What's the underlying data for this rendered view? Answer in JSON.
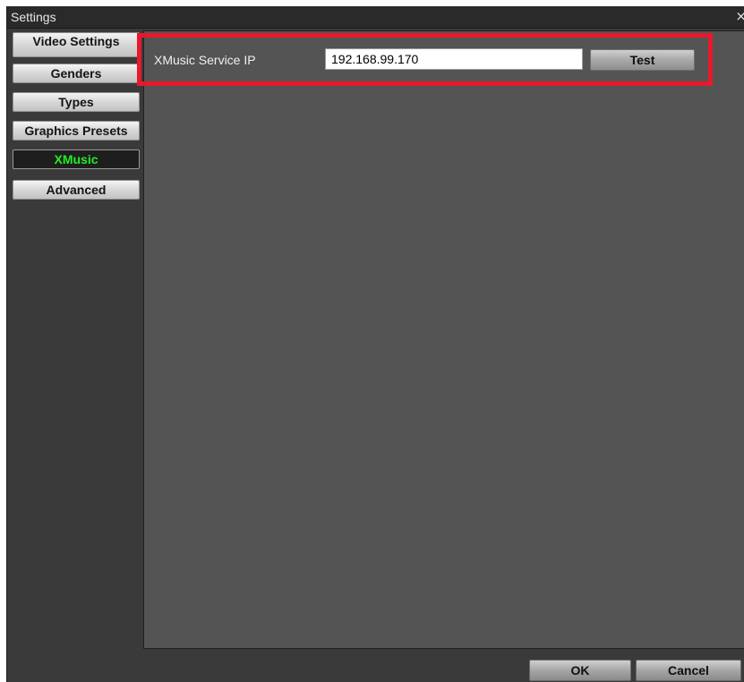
{
  "window": {
    "title": "Settings",
    "close_glyph": "×"
  },
  "sidebar": {
    "items": [
      {
        "label": "Video Settings",
        "active": false
      },
      {
        "label": "Genders",
        "active": false
      },
      {
        "label": "Types",
        "active": false
      },
      {
        "label": "Graphics Presets",
        "active": false
      },
      {
        "label": "XMusic",
        "active": true
      },
      {
        "label": "Advanced",
        "active": false
      }
    ]
  },
  "xmusic": {
    "service_ip_label": "XMusic Service IP",
    "service_ip_value": "192.168.99.170",
    "test_label": "Test"
  },
  "footer": {
    "ok_label": "OK",
    "cancel_label": "Cancel"
  },
  "colors": {
    "active_tab_text": "#22ee22",
    "highlight_border": "#e8192c",
    "panel_background": "#545454"
  }
}
